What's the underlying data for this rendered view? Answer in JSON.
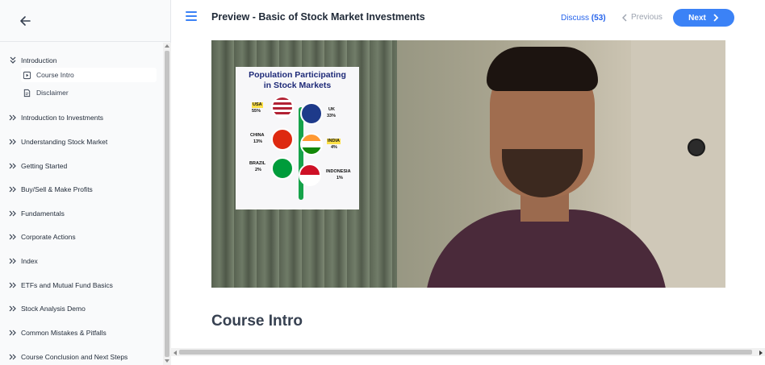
{
  "header": {
    "title": "Preview - Basic of Stock Market Investments",
    "discuss_label": "Discuss",
    "discuss_count": "(53)",
    "previous_label": "Previous",
    "next_label": "Next"
  },
  "sidebar": {
    "back_icon": "arrow-left-icon",
    "sections": [
      {
        "label": "Introduction",
        "expanded": true
      },
      {
        "label": "Introduction to Investments"
      },
      {
        "label": "Understanding Stock Market"
      },
      {
        "label": "Getting Started"
      },
      {
        "label": "Buy/Sell & Make Profits"
      },
      {
        "label": "Fundamentals"
      },
      {
        "label": "Corporate Actions"
      },
      {
        "label": "Index"
      },
      {
        "label": "ETFs and Mutual Fund Basics"
      },
      {
        "label": "Stock Analysis Demo"
      },
      {
        "label": "Common Mistakes & Pitfalls"
      },
      {
        "label": "Course Conclusion and Next Steps"
      }
    ],
    "lessons": [
      {
        "label": "Course Intro",
        "active": true
      },
      {
        "label": "Disclaimer"
      }
    ]
  },
  "video": {
    "infographic": {
      "title_line1": "Population Participating",
      "title_line2": "in Stock Markets",
      "countries": [
        {
          "name": "USA",
          "value": "55%",
          "highlight": true
        },
        {
          "name": "UK",
          "value": "33%"
        },
        {
          "name": "CHINA",
          "value": "13%"
        },
        {
          "name": "INDIA",
          "value": "4%",
          "highlight": true
        },
        {
          "name": "BRAZIL",
          "value": "2%"
        },
        {
          "name": "INDONESIA",
          "value": "1%"
        }
      ]
    }
  },
  "content": {
    "lesson_title": "Course Intro"
  },
  "colors": {
    "accent": "#3b82f6",
    "link": "#2563eb"
  }
}
